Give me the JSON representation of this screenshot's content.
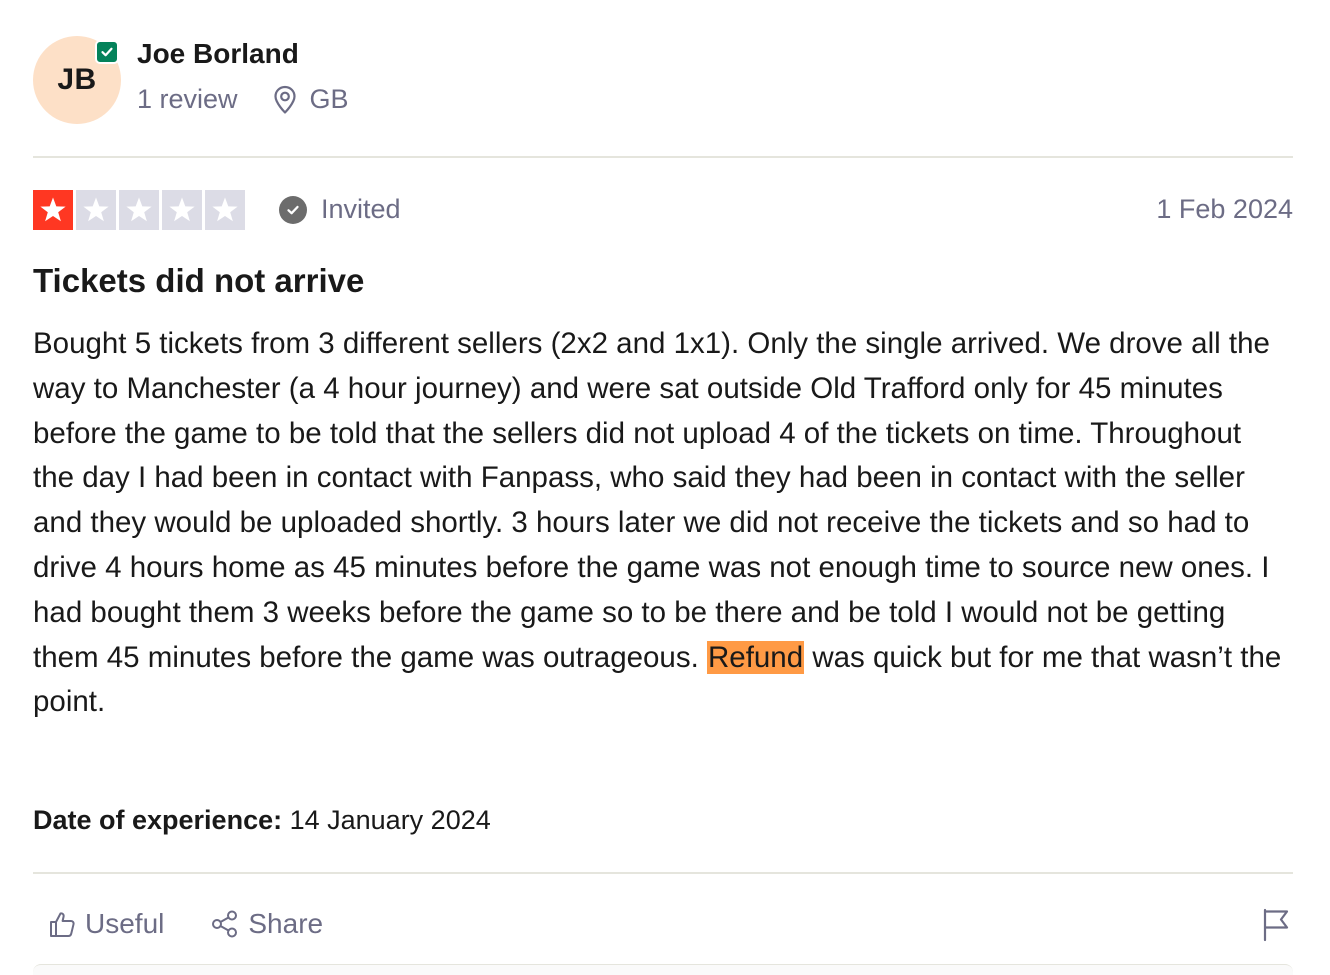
{
  "reviewer": {
    "initials": "JB",
    "name": "Joe Borland",
    "review_count": "1 review",
    "country": "GB",
    "avatar_color": "#fde0c7",
    "verified_color": "#04825a"
  },
  "review": {
    "rating": 1,
    "rating_max": 5,
    "rating_color": "#ff3722",
    "status": "Invited",
    "date": "1 Feb 2024",
    "title": "Tickets did not arrive",
    "body_before": "Bought 5 tickets from 3 different sellers (2x2 and 1x1). Only the single arrived. We drove all the way to Manchester (a 4 hour journey) and were sat outside Old Trafford only for 45 minutes before the game to be told that the sellers did not upload 4 of the tickets on time. Throughout the day I had been in contact with Fanpass, who said they had been in contact with the seller and they would be uploaded shortly. 3 hours later we did not receive the tickets and so had to drive 4 hours home as 45 minutes before the game was not enough time to source new ones. I had bought them 3 weeks before the game so to be there and be told I would not be getting them 45 minutes before the game was outrageous. ",
    "body_highlight": "Refund",
    "body_after": " was quick but for me that wasn’t the point.",
    "highlight_color": "#ff9a45",
    "experience_label": "Date of experience:",
    "experience_date": " 14 January 2024"
  },
  "actions": {
    "useful_label": "Useful",
    "share_label": "Share",
    "useful_icon": "thumbs-up-icon",
    "share_icon": "share-icon",
    "flag_icon": "flag-icon"
  }
}
